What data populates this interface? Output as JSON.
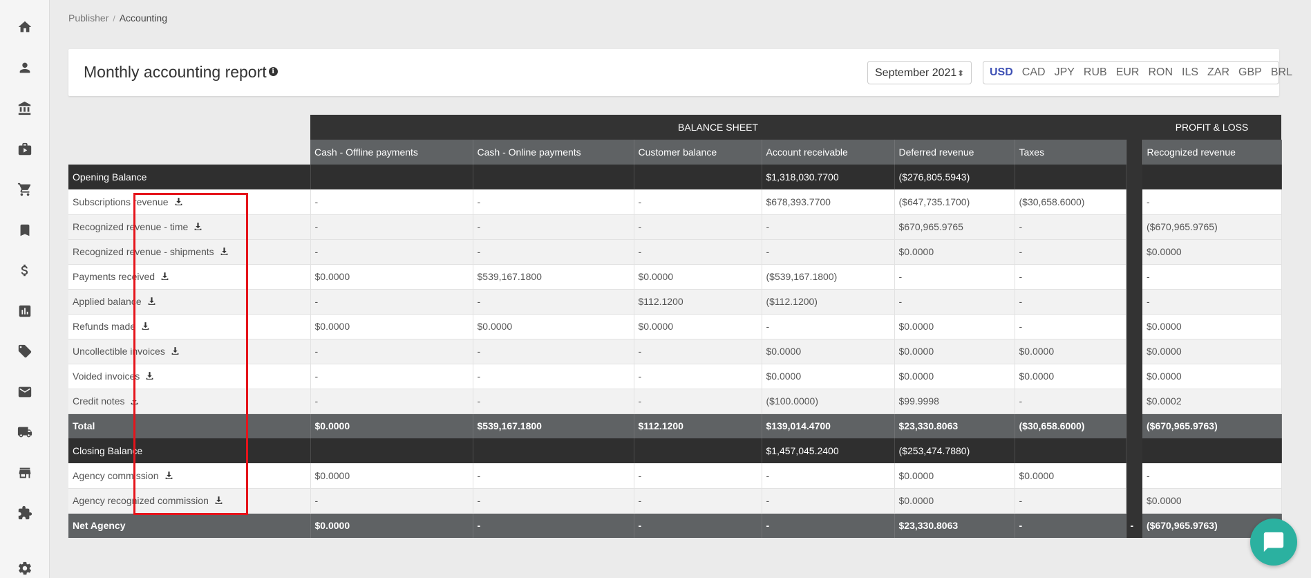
{
  "breadcrumb": {
    "parent": "Publisher",
    "separator": "/",
    "current": "Accounting"
  },
  "card": {
    "title": "Monthly accounting report",
    "info_glyph": "i",
    "month": "September 2021",
    "currencies": [
      "USD",
      "CAD",
      "JPY",
      "RUB",
      "EUR",
      "RON",
      "ILS",
      "ZAR",
      "GBP",
      "BRL"
    ],
    "active_currency": "USD"
  },
  "sidebar": {
    "icons": [
      "home-icon",
      "user-icon",
      "bank-icon",
      "briefcase-icon",
      "cart-icon",
      "bookmark-icon",
      "dollar-icon",
      "chart-icon",
      "ticket-icon",
      "mail-icon",
      "truck-icon",
      "store-icon",
      "puzzle-icon",
      "gear-icon"
    ]
  },
  "table": {
    "group_headers": {
      "balance_sheet": "BALANCE SHEET",
      "profit_loss": "PROFIT & LOSS"
    },
    "columns": [
      "Cash - Offline payments",
      "Cash - Online payments",
      "Customer balance",
      "Account receivable",
      "Deferred revenue",
      "Taxes",
      "Recognized revenue"
    ],
    "rows": [
      {
        "label": "Opening Balance",
        "style": "dark",
        "download": false,
        "cells": [
          "",
          "",
          "",
          "$1,318,030.7700",
          "($276,805.5943)",
          "",
          ""
        ],
        "gap": ""
      },
      {
        "label": "Subscriptions revenue",
        "style": "white",
        "download": true,
        "cells": [
          "-",
          "-",
          "-",
          "$678,393.7700",
          "($647,735.1700)",
          "($30,658.6000)",
          "-"
        ],
        "gap": ""
      },
      {
        "label": "Recognized revenue - time",
        "style": "grey",
        "download": true,
        "cells": [
          "-",
          "-",
          "-",
          "-",
          "$670,965.9765",
          "-",
          "($670,965.9765)"
        ],
        "gap": ""
      },
      {
        "label": "Recognized revenue - shipments",
        "style": "grey",
        "download": true,
        "cells": [
          "-",
          "-",
          "-",
          "-",
          "$0.0000",
          "-",
          "$0.0000"
        ],
        "gap": ""
      },
      {
        "label": "Payments received",
        "style": "white",
        "download": true,
        "cells": [
          "$0.0000",
          "$539,167.1800",
          "$0.0000",
          "($539,167.1800)",
          "-",
          "-",
          "-"
        ],
        "gap": ""
      },
      {
        "label": "Applied balance",
        "style": "grey",
        "download": true,
        "cells": [
          "-",
          "-",
          "$112.1200",
          "($112.1200)",
          "-",
          "-",
          "-"
        ],
        "gap": ""
      },
      {
        "label": "Refunds made",
        "style": "white",
        "download": true,
        "cells": [
          "$0.0000",
          "$0.0000",
          "$0.0000",
          "-",
          "$0.0000",
          "-",
          "$0.0000"
        ],
        "gap": ""
      },
      {
        "label": "Uncollectible invoices",
        "style": "grey",
        "download": true,
        "cells": [
          "-",
          "-",
          "-",
          "$0.0000",
          "$0.0000",
          "$0.0000",
          "$0.0000"
        ],
        "gap": ""
      },
      {
        "label": "Voided invoices",
        "style": "white",
        "download": true,
        "cells": [
          "-",
          "-",
          "-",
          "$0.0000",
          "$0.0000",
          "$0.0000",
          "$0.0000"
        ],
        "gap": ""
      },
      {
        "label": "Credit notes",
        "style": "grey",
        "download": true,
        "cells": [
          "-",
          "-",
          "-",
          "($100.0000)",
          "$99.9998",
          "-",
          "$0.0002"
        ],
        "gap": ""
      },
      {
        "label": "Total",
        "style": "mid",
        "download": false,
        "cells": [
          "$0.0000",
          "$539,167.1800",
          "$112.1200",
          "$139,014.4700",
          "$23,330.8063",
          "($30,658.6000)",
          "($670,965.9763)"
        ],
        "gap": ""
      },
      {
        "label": "Closing Balance",
        "style": "dark",
        "download": false,
        "cells": [
          "",
          "",
          "",
          "$1,457,045.2400",
          "($253,474.7880)",
          "",
          ""
        ],
        "gap": ""
      },
      {
        "label": "Agency commission",
        "style": "white",
        "download": true,
        "cells": [
          "$0.0000",
          "-",
          "-",
          "-",
          "$0.0000",
          "$0.0000",
          "-"
        ],
        "gap": ""
      },
      {
        "label": "Agency recognized commission",
        "style": "grey",
        "download": true,
        "cells": [
          "-",
          "-",
          "-",
          "-",
          "$0.0000",
          "-",
          "$0.0000"
        ],
        "gap": ""
      },
      {
        "label": "Net Agency",
        "style": "mid",
        "download": false,
        "cells": [
          "$0.0000",
          "-",
          "-",
          "-",
          "$23,330.8063",
          "-",
          "($670,965.9763)"
        ],
        "gap": "-"
      }
    ]
  },
  "colors": {
    "accent": "#3f51b5",
    "highlight": "#e5141b",
    "chat": "#2bb1a0"
  }
}
